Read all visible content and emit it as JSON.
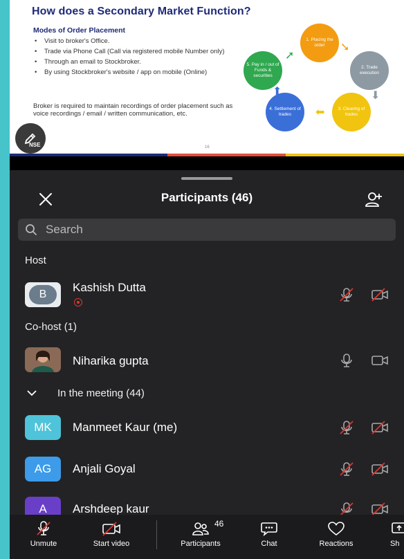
{
  "slide": {
    "title": "How does a Secondary Market Function?",
    "subtitle": "Modes of Order Placement",
    "bullets": [
      "Visit to broker's Office.",
      "Trade via Phone Call (Call via registered mobile Number only)",
      "Through an email to Stockbroker.",
      "By using Stockbroker's website / app on mobile (Online)"
    ],
    "note": "Broker is required to maintain recordings of order placement such as voice recordings / email / written communication, etc.",
    "page_number": "16",
    "logo_text": "NSE",
    "cycle": [
      {
        "label": "1. Placing the order",
        "color": "#f39c12"
      },
      {
        "label": "2. Trade execution",
        "color": "#8e9aa3"
      },
      {
        "label": "3. Clearing of trades",
        "color": "#f1c40f"
      },
      {
        "label": "4. Settlement of trades",
        "color": "#3b6fd8"
      },
      {
        "label": "5. Pay in / out of Funds & securities",
        "color": "#2fa84f"
      }
    ]
  },
  "panel": {
    "title": "Participants (46)",
    "search_placeholder": "Search",
    "sections": {
      "host": "Host",
      "cohost": "Co-host (1)",
      "meeting": "In the meeting (44)"
    },
    "host": {
      "initial": "B",
      "name": "Kashish Dutta",
      "avatar_color": "#e9ecef"
    },
    "cohost": {
      "name": "Niharika gupta"
    },
    "participants": [
      {
        "initials": "MK",
        "name": "Manmeet Kaur (me)",
        "color": "#4fc3d9"
      },
      {
        "initials": "AG",
        "name": "Anjali Goyal",
        "color": "#3d9be9"
      },
      {
        "initials": "A",
        "name": "Arshdeep kaur",
        "color": "#6a3fc8"
      }
    ]
  },
  "toolbar": {
    "unmute": "Unmute",
    "start_video": "Start video",
    "participants": "Participants",
    "participants_count": "46",
    "chat": "Chat",
    "reactions": "Reactions",
    "share": "Sh"
  }
}
